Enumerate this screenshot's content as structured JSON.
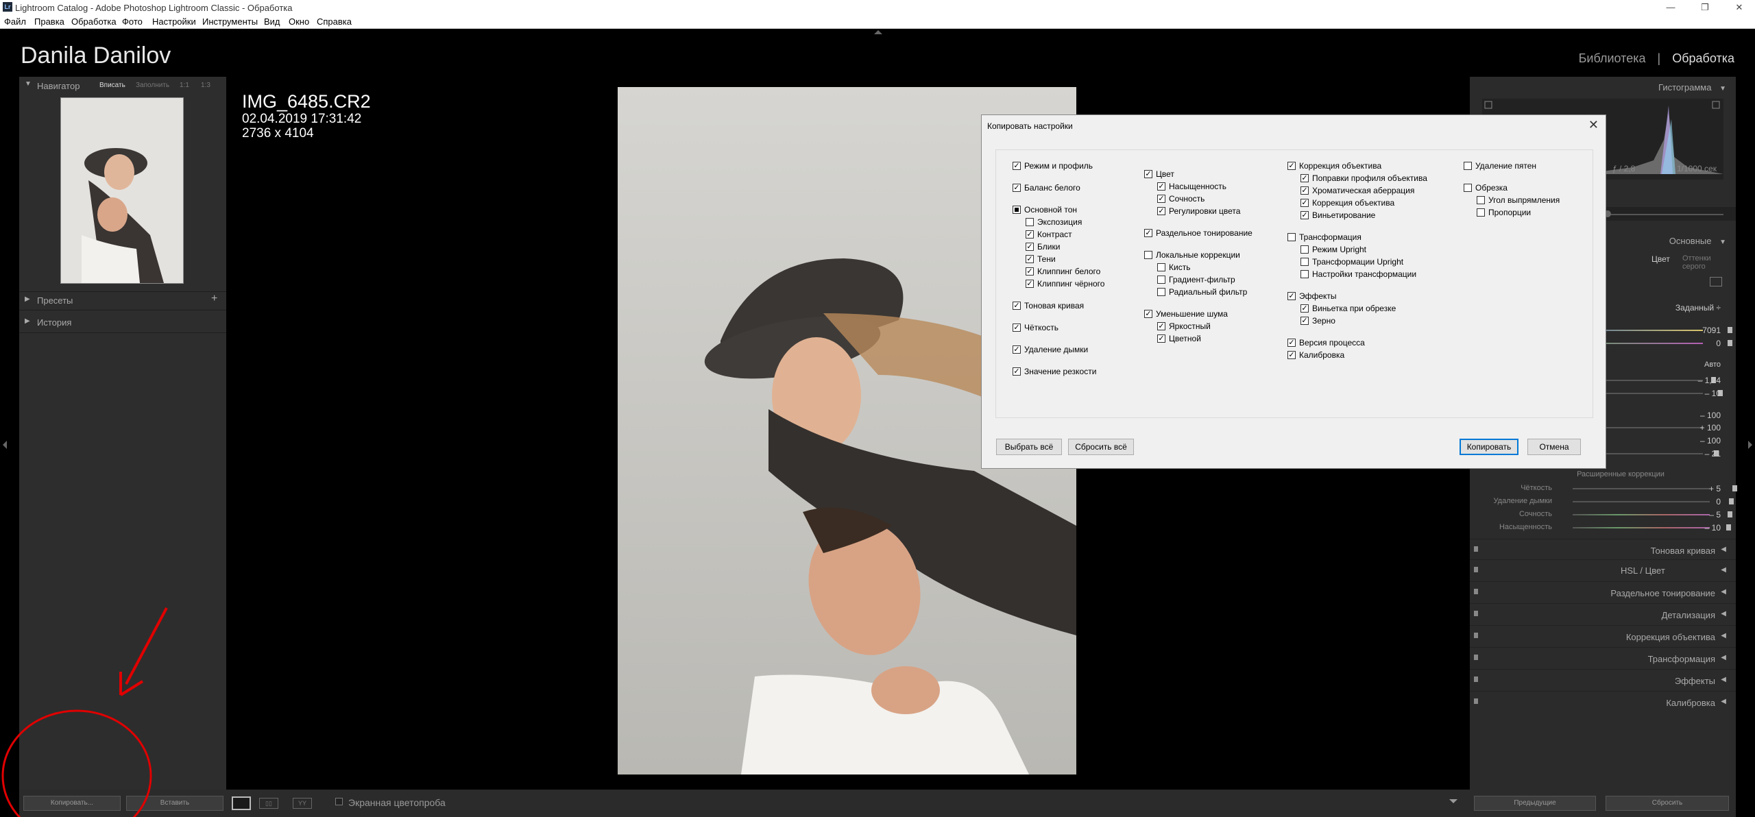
{
  "window": {
    "app_icon": "Lr",
    "title": "Lightroom Catalog - Adobe Photoshop Lightroom Classic - Обработка",
    "minimize": "—",
    "maximize": "❐",
    "close": "✕"
  },
  "menu": [
    "Файл",
    "Правка",
    "Обработка",
    "Фото",
    "Настройки",
    "Инструменты",
    "Вид",
    "Окно",
    "Справка"
  ],
  "identity_plate": "Danila Danilov",
  "modules": {
    "library": "Библиотека",
    "separator": "|",
    "develop": "Обработка"
  },
  "navigator": {
    "title": "Навигатор",
    "fit": "Вписать",
    "fill": "Заполнить",
    "one_to_one": "1:1",
    "ratio": "1:3"
  },
  "left_sections": {
    "presets": "Пресеты",
    "history": "История",
    "add": "+"
  },
  "image_info": {
    "filename": "IMG_6485.CR2",
    "datetime": "02.04.2019 17:31:42",
    "dimensions": "2736 x 4104"
  },
  "bottom_left": {
    "copy": "Копировать...",
    "paste": "Вставить"
  },
  "toolbar": {
    "softproof": "Экранная цветопроба"
  },
  "bottom_right": {
    "previous": "Предыдущие",
    "reset": "Сбросить"
  },
  "right_panel": {
    "histogram": "Гистограмма",
    "aperture": "ƒ / 2,8",
    "shutter": "1/1000 сек",
    "basic": "Основные",
    "color": "Цвет",
    "bw": "Оттенки серого",
    "wb_mode": "Заданный ÷",
    "temp": "7091",
    "tint": "0",
    "auto": "Авто",
    "exposure": "– 1,24",
    "contrast": "– 10",
    "highlights": "– 100",
    "shadows": "+ 100",
    "whites": "– 100",
    "blacks": "– 21",
    "presence": "Расширенные коррекции",
    "clarity_label": "Чёткость",
    "clarity": "+ 5",
    "dehaze_label": "Удаление дымки",
    "dehaze": "0",
    "vibrance_label": "Сочность",
    "vibrance": "– 5",
    "saturation_label": "Насыщенность",
    "saturation": "– 10",
    "panels": [
      "Тоновая кривая",
      "HSL / Цвет",
      "Раздельное тонирование",
      "Детализация",
      "Коррекция объектива",
      "Трансформация",
      "Эффекты",
      "Калибровка"
    ]
  },
  "dialog": {
    "title": "Копировать настройки",
    "close": "✕",
    "select_all": "Выбрать всё",
    "reset_all": "Сбросить всё",
    "copy": "Копировать",
    "cancel": "Отмена",
    "col1": [
      {
        "label": "Режим и профиль",
        "state": "checked",
        "indent": 0
      },
      {
        "label": "Баланс белого",
        "state": "checked",
        "indent": 0
      },
      {
        "label": "Основной тон",
        "state": "mixed",
        "indent": 0
      },
      {
        "label": "Экспозиция",
        "state": "unchecked",
        "indent": 1
      },
      {
        "label": "Контраст",
        "state": "checked",
        "indent": 1
      },
      {
        "label": "Блики",
        "state": "checked",
        "indent": 1
      },
      {
        "label": "Тени",
        "state": "checked",
        "indent": 1
      },
      {
        "label": "Клиппинг белого",
        "state": "checked",
        "indent": 1
      },
      {
        "label": "Клиппинг чёрного",
        "state": "checked",
        "indent": 1
      },
      {
        "label": "Тоновая кривая",
        "state": "checked",
        "indent": 0
      },
      {
        "label": "Чёткость",
        "state": "checked",
        "indent": 0
      },
      {
        "label": "Удаление дымки",
        "state": "checked",
        "indent": 0
      },
      {
        "label": "Значение резкости",
        "state": "checked",
        "indent": 0
      }
    ],
    "col2": [
      {
        "label": "Цвет",
        "state": "checked",
        "indent": 0
      },
      {
        "label": "Насыщенность",
        "state": "checked",
        "indent": 1
      },
      {
        "label": "Сочность",
        "state": "checked",
        "indent": 1
      },
      {
        "label": "Регулировки цвета",
        "state": "checked",
        "indent": 1
      },
      {
        "label": "Раздельное тонирование",
        "state": "checked",
        "indent": 0
      },
      {
        "label": "Локальные коррекции",
        "state": "unchecked",
        "indent": 0
      },
      {
        "label": "Кисть",
        "state": "unchecked",
        "indent": 1
      },
      {
        "label": "Градиент-фильтр",
        "state": "unchecked",
        "indent": 1
      },
      {
        "label": "Радиальный фильтр",
        "state": "unchecked",
        "indent": 1
      },
      {
        "label": "Уменьшение шума",
        "state": "checked",
        "indent": 0
      },
      {
        "label": "Яркостный",
        "state": "checked",
        "indent": 1
      },
      {
        "label": "Цветной",
        "state": "checked",
        "indent": 1
      }
    ],
    "col3": [
      {
        "label": "Коррекция объектива",
        "state": "checked",
        "indent": 0
      },
      {
        "label": "Поправки профиля объектива",
        "state": "checked",
        "indent": 1
      },
      {
        "label": "Хроматическая аберрация",
        "state": "checked",
        "indent": 1
      },
      {
        "label": "Коррекция объектива",
        "state": "checked",
        "indent": 1
      },
      {
        "label": "Виньетирование",
        "state": "checked",
        "indent": 1
      },
      {
        "label": "Трансформация",
        "state": "unchecked",
        "indent": 0
      },
      {
        "label": "Режим Upright",
        "state": "unchecked",
        "indent": 1
      },
      {
        "label": "Трансформации Upright",
        "state": "unchecked",
        "indent": 1
      },
      {
        "label": "Настройки трансформации",
        "state": "unchecked",
        "indent": 1
      },
      {
        "label": "Эффекты",
        "state": "checked",
        "indent": 0
      },
      {
        "label": "Виньетка при обрезке",
        "state": "checked",
        "indent": 1
      },
      {
        "label": "Зерно",
        "state": "checked",
        "indent": 1
      },
      {
        "label": "Версия процесса",
        "state": "checked",
        "indent": 0
      },
      {
        "label": "Калибровка",
        "state": "checked",
        "indent": 0
      }
    ],
    "col4": [
      {
        "label": "Удаление пятен",
        "state": "unchecked",
        "indent": 0
      },
      {
        "label": "Обрезка",
        "state": "unchecked",
        "indent": 0
      },
      {
        "label": "Угол выпрямления",
        "state": "unchecked",
        "indent": 1
      },
      {
        "label": "Пропорции",
        "state": "unchecked",
        "indent": 1
      }
    ]
  },
  "colors": {
    "annotation": "#e00000",
    "accent_button": "#0078d7"
  }
}
